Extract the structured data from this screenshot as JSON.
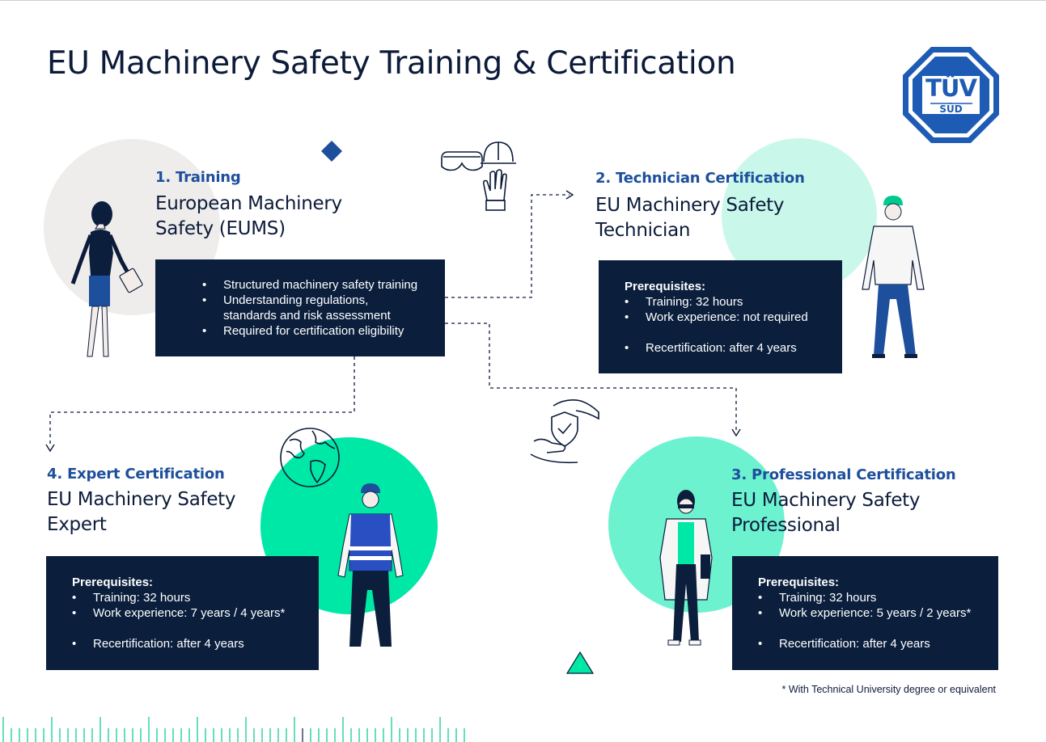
{
  "title": "EU Machinery Safety Training & Certification",
  "logo": {
    "text_top": "TÜV",
    "text_bottom": "SÜD",
    "color": "#1d5bb5"
  },
  "colors": {
    "navy": "#0b1f3d",
    "accent_blue": "#1d4f9c",
    "green_strong": "#00e8a6",
    "green_mid": "#6cf2cf",
    "green_light": "#c9f8ea",
    "grey_circle": "#efedec"
  },
  "steps": {
    "training": {
      "label": "1. Training",
      "name_line1": "European Machinery",
      "name_line2": "Safety (EUMS)",
      "bullets": [
        "Structured machinery safety training",
        "Understanding regulations,",
        "standards and risk assessment",
        "Required for certification eligibility"
      ]
    },
    "technician": {
      "label": "2. Technician Certification",
      "name_line1": "EU Machinery Safety",
      "name_line2": "Technician",
      "prereq_heading": "Prerequisites:",
      "training": "Training: 32 hours",
      "experience": "Work experience: not required",
      "recert": "Recertification: after 4 years"
    },
    "professional": {
      "label": "3. Professional Certification",
      "name_line1": "EU Machinery Safety",
      "name_line2": "Professional",
      "prereq_heading": "Prerequisites:",
      "training": "Training: 32 hours",
      "experience": "Work experience: 5 years / 2 years*",
      "recert": "Recertification: after 4 years"
    },
    "expert": {
      "label": "4. Expert Certification",
      "name_line1": "EU Machinery Safety",
      "name_line2": "Expert",
      "prereq_heading": "Prerequisites:",
      "training": "Training: 32 hours",
      "experience": "Work experience: 7 years  / 4 years*",
      "recert": "Recertification: after 4 years"
    }
  },
  "footnote": "* With Technical University degree or equivalent",
  "icons": [
    "safety-glasses-icon",
    "hard-hat-icon",
    "glove-icon",
    "globe-icon",
    "shield-check-hands-icon",
    "diamond-icon",
    "triangle-icon"
  ]
}
